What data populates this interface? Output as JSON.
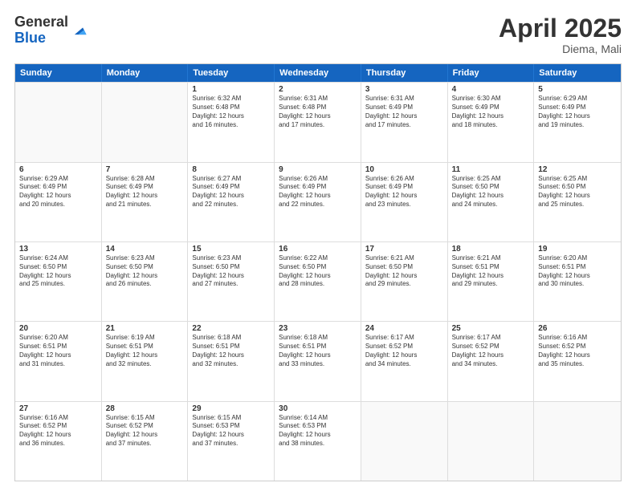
{
  "header": {
    "logo_general": "General",
    "logo_blue": "Blue",
    "month_title": "April 2025",
    "location": "Diema, Mali"
  },
  "weekdays": [
    "Sunday",
    "Monday",
    "Tuesday",
    "Wednesday",
    "Thursday",
    "Friday",
    "Saturday"
  ],
  "rows": [
    [
      {
        "day": "",
        "empty": true
      },
      {
        "day": "",
        "empty": true
      },
      {
        "day": "1",
        "sunrise": "6:32 AM",
        "sunset": "6:48 PM",
        "daylight": "12 hours and 16 minutes."
      },
      {
        "day": "2",
        "sunrise": "6:31 AM",
        "sunset": "6:48 PM",
        "daylight": "12 hours and 17 minutes."
      },
      {
        "day": "3",
        "sunrise": "6:31 AM",
        "sunset": "6:49 PM",
        "daylight": "12 hours and 17 minutes."
      },
      {
        "day": "4",
        "sunrise": "6:30 AM",
        "sunset": "6:49 PM",
        "daylight": "12 hours and 18 minutes."
      },
      {
        "day": "5",
        "sunrise": "6:29 AM",
        "sunset": "6:49 PM",
        "daylight": "12 hours and 19 minutes."
      }
    ],
    [
      {
        "day": "6",
        "sunrise": "6:29 AM",
        "sunset": "6:49 PM",
        "daylight": "12 hours and 20 minutes."
      },
      {
        "day": "7",
        "sunrise": "6:28 AM",
        "sunset": "6:49 PM",
        "daylight": "12 hours and 21 minutes."
      },
      {
        "day": "8",
        "sunrise": "6:27 AM",
        "sunset": "6:49 PM",
        "daylight": "12 hours and 22 minutes."
      },
      {
        "day": "9",
        "sunrise": "6:26 AM",
        "sunset": "6:49 PM",
        "daylight": "12 hours and 22 minutes."
      },
      {
        "day": "10",
        "sunrise": "6:26 AM",
        "sunset": "6:49 PM",
        "daylight": "12 hours and 23 minutes."
      },
      {
        "day": "11",
        "sunrise": "6:25 AM",
        "sunset": "6:50 PM",
        "daylight": "12 hours and 24 minutes."
      },
      {
        "day": "12",
        "sunrise": "6:25 AM",
        "sunset": "6:50 PM",
        "daylight": "12 hours and 25 minutes."
      }
    ],
    [
      {
        "day": "13",
        "sunrise": "6:24 AM",
        "sunset": "6:50 PM",
        "daylight": "12 hours and 25 minutes."
      },
      {
        "day": "14",
        "sunrise": "6:23 AM",
        "sunset": "6:50 PM",
        "daylight": "12 hours and 26 minutes."
      },
      {
        "day": "15",
        "sunrise": "6:23 AM",
        "sunset": "6:50 PM",
        "daylight": "12 hours and 27 minutes."
      },
      {
        "day": "16",
        "sunrise": "6:22 AM",
        "sunset": "6:50 PM",
        "daylight": "12 hours and 28 minutes."
      },
      {
        "day": "17",
        "sunrise": "6:21 AM",
        "sunset": "6:50 PM",
        "daylight": "12 hours and 29 minutes."
      },
      {
        "day": "18",
        "sunrise": "6:21 AM",
        "sunset": "6:51 PM",
        "daylight": "12 hours and 29 minutes."
      },
      {
        "day": "19",
        "sunrise": "6:20 AM",
        "sunset": "6:51 PM",
        "daylight": "12 hours and 30 minutes."
      }
    ],
    [
      {
        "day": "20",
        "sunrise": "6:20 AM",
        "sunset": "6:51 PM",
        "daylight": "12 hours and 31 minutes."
      },
      {
        "day": "21",
        "sunrise": "6:19 AM",
        "sunset": "6:51 PM",
        "daylight": "12 hours and 32 minutes."
      },
      {
        "day": "22",
        "sunrise": "6:18 AM",
        "sunset": "6:51 PM",
        "daylight": "12 hours and 32 minutes."
      },
      {
        "day": "23",
        "sunrise": "6:18 AM",
        "sunset": "6:51 PM",
        "daylight": "12 hours and 33 minutes."
      },
      {
        "day": "24",
        "sunrise": "6:17 AM",
        "sunset": "6:52 PM",
        "daylight": "12 hours and 34 minutes."
      },
      {
        "day": "25",
        "sunrise": "6:17 AM",
        "sunset": "6:52 PM",
        "daylight": "12 hours and 34 minutes."
      },
      {
        "day": "26",
        "sunrise": "6:16 AM",
        "sunset": "6:52 PM",
        "daylight": "12 hours and 35 minutes."
      }
    ],
    [
      {
        "day": "27",
        "sunrise": "6:16 AM",
        "sunset": "6:52 PM",
        "daylight": "12 hours and 36 minutes."
      },
      {
        "day": "28",
        "sunrise": "6:15 AM",
        "sunset": "6:52 PM",
        "daylight": "12 hours and 37 minutes."
      },
      {
        "day": "29",
        "sunrise": "6:15 AM",
        "sunset": "6:53 PM",
        "daylight": "12 hours and 37 minutes."
      },
      {
        "day": "30",
        "sunrise": "6:14 AM",
        "sunset": "6:53 PM",
        "daylight": "12 hours and 38 minutes."
      },
      {
        "day": "",
        "empty": true
      },
      {
        "day": "",
        "empty": true
      },
      {
        "day": "",
        "empty": true
      }
    ]
  ],
  "labels": {
    "sunrise": "Sunrise:",
    "sunset": "Sunset:",
    "daylight": "Daylight:"
  }
}
